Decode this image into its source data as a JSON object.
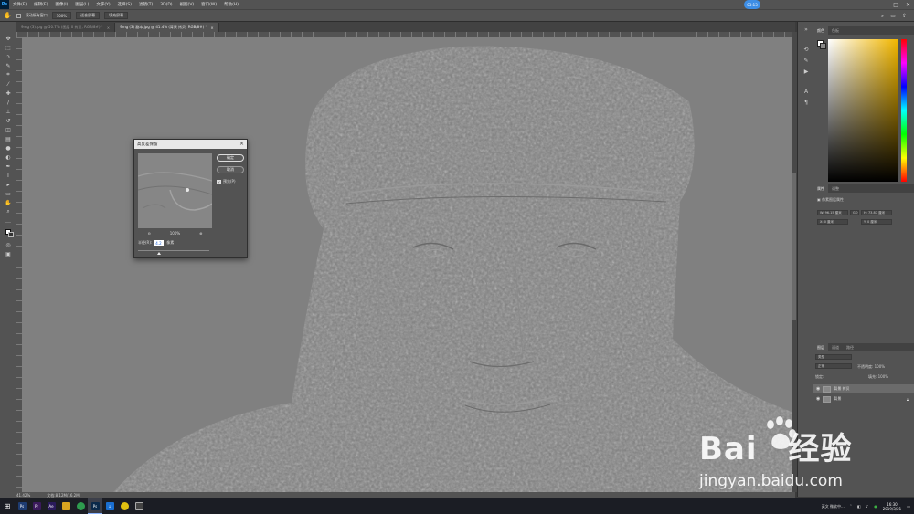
{
  "menubar": {
    "items": [
      "文件(F)",
      "编辑(E)",
      "图像(I)",
      "图层(L)",
      "文字(Y)",
      "选择(S)",
      "滤镜(T)",
      "3D(D)",
      "视图(V)",
      "窗口(W)",
      "帮助(H)"
    ],
    "time_bubble": "03:13"
  },
  "options": {
    "scroll_all_label": "滚动所有窗口",
    "zoom_value": "100%",
    "fit_screen_label": "适合屏幕",
    "fill_screen_label": "填充屏幕"
  },
  "tabs": [
    {
      "label": "9mg (3).jpg @ 50.7% (图层 0 拷贝, RGB/8#) *"
    },
    {
      "label": "9mg (3) 副本.jpg @ 41.4% (背景 拷贝, RGB/8#) *"
    }
  ],
  "status": {
    "zoom": "41.42%",
    "doc_size": "文档:8.12M/16.2M"
  },
  "color_panel": {
    "tabs": [
      "颜色",
      "色板"
    ],
    "hue_accent": "#f2b700"
  },
  "properties_panel": {
    "tabs": [
      "属性",
      "调整"
    ],
    "subtitle": "像素图层属性",
    "w_label": "W:",
    "w_value": "96.15 厘米",
    "h_label": "H:",
    "h_value": "73.87 厘米",
    "x_label": "X:",
    "x_value": "0 厘米",
    "y_label": "Y:",
    "y_value": "0 厘米",
    "link": "GO"
  },
  "layers_panel": {
    "tabs": [
      "图层",
      "通道",
      "路径"
    ],
    "search_placeholder": "类型",
    "blend_mode": "正常",
    "opacity_label": "不透明度:",
    "opacity_value": "100%",
    "lock_label": "锁定:",
    "fill_label": "填充:",
    "fill_value": "100%",
    "layers": [
      {
        "name": "背景 拷贝",
        "selected": true
      },
      {
        "name": "背景",
        "selected": false
      }
    ]
  },
  "dialog": {
    "title": "高反差保留",
    "ok_label": "确定",
    "cancel_label": "取消",
    "preview_label": "预览(P)",
    "preview_checked": true,
    "zoom_label": "100%",
    "radius_label": "半径(R):",
    "radius_value": "4.2",
    "radius_unit": "像素",
    "radius_slider_fraction": 0.3
  },
  "taskbar": {
    "apps": [
      {
        "name": "photoshop-cc",
        "letter": "Ps",
        "color": "#1e3c72"
      },
      {
        "name": "premiere",
        "letter": "Pr",
        "color": "#3b1a5c"
      },
      {
        "name": "after-effects",
        "letter": "Ae",
        "color": "#2a1a5c"
      },
      {
        "name": "file-explorer",
        "letter": "",
        "color": "#d9a520"
      },
      {
        "name": "chrome",
        "letter": "",
        "color": "#2e9b4e"
      },
      {
        "name": "photoshop",
        "letter": "Ps",
        "color": "#0b2a4a"
      },
      {
        "name": "download",
        "letter": "↓",
        "color": "#1a6fd1"
      },
      {
        "name": "app-yellow",
        "letter": "",
        "color": "#e0c010"
      },
      {
        "name": "photos",
        "letter": "",
        "color": "#444"
      }
    ],
    "tray_text": "英文 微软中...",
    "clock_time": "16:30",
    "clock_date": "2019/3/21"
  },
  "watermark": {
    "brand": "Bai",
    "brand2": "经验",
    "url": "jingyan.baidu.com"
  }
}
